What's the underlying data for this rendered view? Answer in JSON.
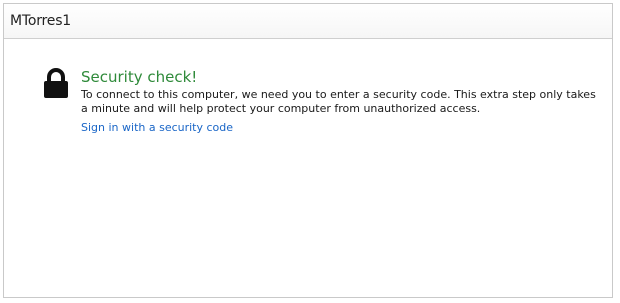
{
  "header": {
    "username": "MTorres1"
  },
  "security": {
    "icon": "lock-icon",
    "heading": "Security check!",
    "message": "To connect to this computer, we need you to enter a security code. This extra step only takes a minute and will help protect your computer from unauthorized access.",
    "link_label": "Sign in with a security code"
  },
  "colors": {
    "heading": "#2f8a3a",
    "link": "#1a66c7"
  }
}
